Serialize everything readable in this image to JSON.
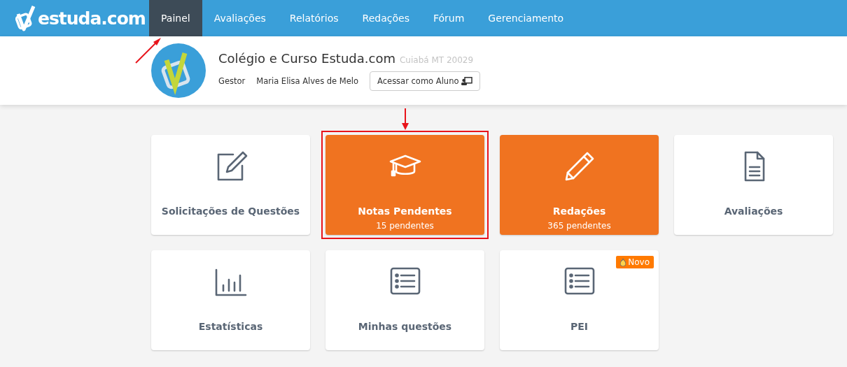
{
  "logo": {
    "text": "estuda.com"
  },
  "nav": [
    {
      "label": "Painel",
      "selected": true
    },
    {
      "label": "Avaliações",
      "selected": false
    },
    {
      "label": "Relatórios",
      "selected": false
    },
    {
      "label": "Redações",
      "selected": false
    },
    {
      "label": "Fórum",
      "selected": false
    },
    {
      "label": "Gerenciamento",
      "selected": false
    }
  ],
  "school": {
    "name": "Colégio e Curso Estuda.com",
    "location": "Cuiabá MT 20029",
    "role": "Gestor",
    "user": "Maria Elisa Alves de Melo",
    "button": "Acessar como Aluno"
  },
  "cards": [
    {
      "title": "Solicitações de Questões",
      "accent": false,
      "highlighted": false
    },
    {
      "title": "Notas Pendentes",
      "subtitle": "15 pendentes",
      "accent": true,
      "highlighted": true
    },
    {
      "title": "Redações",
      "subtitle": "365 pendentes",
      "accent": true,
      "highlighted": false
    },
    {
      "title": "Avaliações",
      "accent": false,
      "highlighted": false
    },
    {
      "title": "Estatísticas",
      "accent": false,
      "highlighted": false
    },
    {
      "title": "Minhas questões",
      "accent": false,
      "highlighted": false
    },
    {
      "title": "PEI",
      "badge": "Novo",
      "accent": false,
      "highlighted": false
    }
  ]
}
